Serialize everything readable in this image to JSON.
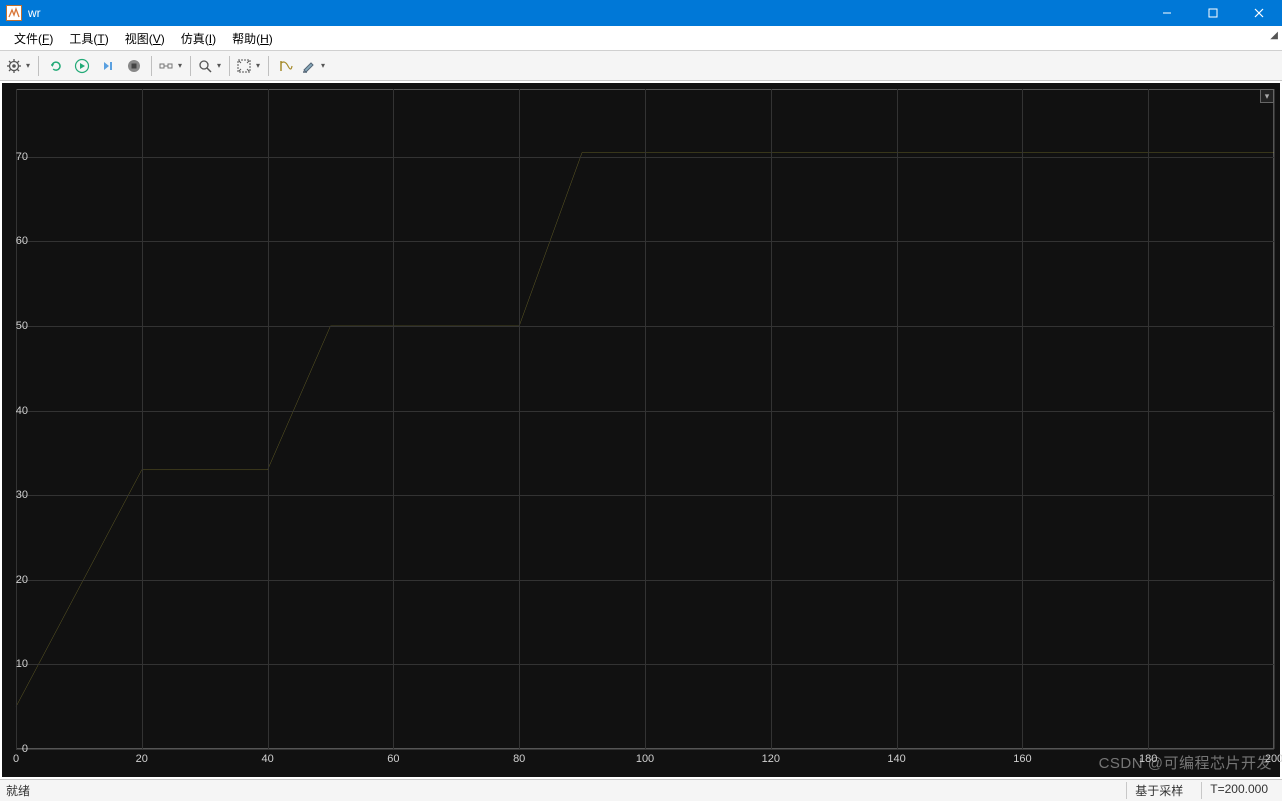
{
  "window": {
    "title": "wr"
  },
  "menu": {
    "file": {
      "label": "文件",
      "accel": "F"
    },
    "tools": {
      "label": "工具",
      "accel": "T"
    },
    "view": {
      "label": "视图",
      "accel": "V"
    },
    "sim": {
      "label": "仿真",
      "accel": "I"
    },
    "help": {
      "label": "帮助",
      "accel": "H"
    }
  },
  "toolbar_icons": {
    "settings": "settings-gear-icon",
    "restart": "restart-icon",
    "run": "run-icon",
    "step": "step-forward-icon",
    "stop": "stop-icon",
    "triggers": "triggers-icon",
    "zoom": "zoom-icon",
    "fit": "fit-to-view-icon",
    "cursor": "cursor-measurements-icon",
    "highlight": "highlight-icon"
  },
  "status": {
    "left": "就绪",
    "mode": "基于采样",
    "time": "T=200.000"
  },
  "watermark": "CSDN @可编程芯片开发",
  "chart_data": {
    "type": "line",
    "xlabel": "",
    "ylabel": "",
    "xlim": [
      0,
      200
    ],
    "ylim": [
      0,
      78
    ],
    "xticks": [
      0,
      20,
      40,
      60,
      80,
      100,
      120,
      140,
      160,
      180,
      200
    ],
    "yticks": [
      0,
      10,
      20,
      30,
      40,
      50,
      60,
      70
    ],
    "grid": true,
    "series": [
      {
        "name": "wr",
        "color": "#f2e24a",
        "x": [
          0,
          20,
          40,
          50,
          80,
          90,
          200
        ],
        "y": [
          5,
          33,
          33,
          50,
          50,
          70.5,
          70.5
        ]
      }
    ]
  }
}
